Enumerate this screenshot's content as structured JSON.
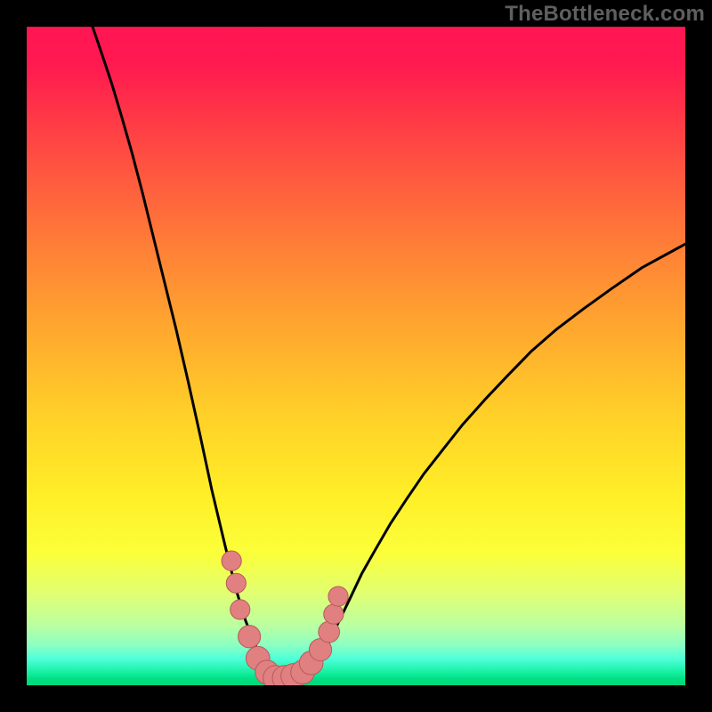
{
  "watermark": "TheBottleneck.com",
  "colors": {
    "frame": "#000000",
    "curve": "#000000",
    "marker_fill": "#e08080",
    "gradient_top": "#ff1552",
    "gradient_bottom": "#00d878"
  },
  "chart_data": {
    "type": "line",
    "title": "",
    "xlabel": "",
    "ylabel": "",
    "xlim": [
      0,
      100
    ],
    "ylim": [
      0,
      100
    ],
    "grid": false,
    "legend": false,
    "left_curve": {
      "description": "Left arm of V curve (x from 10 to ~38), y descends from 100 to 0",
      "x": [
        10.0,
        11.4,
        12.9,
        14.4,
        16.0,
        17.6,
        19.2,
        20.9,
        22.7,
        24.5,
        26.3,
        28.1,
        30.1,
        31.8,
        33.2,
        34.7,
        36.1,
        37.3,
        38.2
      ],
      "y": [
        100.0,
        95.9,
        91.4,
        86.4,
        80.8,
        74.7,
        68.2,
        61.3,
        54.0,
        46.2,
        38.1,
        29.7,
        21.3,
        14.5,
        9.9,
        6.1,
        3.2,
        1.4,
        0.5
      ]
    },
    "right_curve": {
      "description": "Right arm of V curve (x from ~42 to 100), y rises from 0 to ~67",
      "x": [
        41.8,
        42.7,
        44.2,
        45.6,
        47.3,
        49.1,
        50.9,
        53.0,
        55.2,
        57.7,
        60.3,
        63.2,
        66.2,
        69.5,
        73.0,
        76.7,
        80.5,
        84.6,
        88.9,
        93.4,
        100.0
      ],
      "y": [
        0.5,
        1.4,
        3.2,
        5.9,
        9.5,
        13.2,
        17.0,
        20.7,
        24.5,
        28.3,
        32.1,
        35.8,
        39.6,
        43.3,
        47.0,
        50.8,
        54.1,
        57.2,
        60.3,
        63.4,
        67.0
      ]
    },
    "markers": [
      {
        "x": 31.1,
        "y": 18.9,
        "r": 1.5
      },
      {
        "x": 31.8,
        "y": 15.5,
        "r": 1.5
      },
      {
        "x": 32.4,
        "y": 11.5,
        "r": 1.5
      },
      {
        "x": 33.8,
        "y": 7.4,
        "r": 1.7
      },
      {
        "x": 35.1,
        "y": 4.1,
        "r": 1.8
      },
      {
        "x": 36.5,
        "y": 2.0,
        "r": 1.8
      },
      {
        "x": 37.8,
        "y": 1.1,
        "r": 1.9
      },
      {
        "x": 39.2,
        "y": 1.1,
        "r": 1.9
      },
      {
        "x": 40.5,
        "y": 1.4,
        "r": 1.9
      },
      {
        "x": 41.9,
        "y": 2.0,
        "r": 1.8
      },
      {
        "x": 43.2,
        "y": 3.4,
        "r": 1.8
      },
      {
        "x": 44.6,
        "y": 5.4,
        "r": 1.7
      },
      {
        "x": 45.9,
        "y": 8.1,
        "r": 1.6
      },
      {
        "x": 46.6,
        "y": 10.8,
        "r": 1.5
      },
      {
        "x": 47.3,
        "y": 13.5,
        "r": 1.5
      }
    ]
  }
}
